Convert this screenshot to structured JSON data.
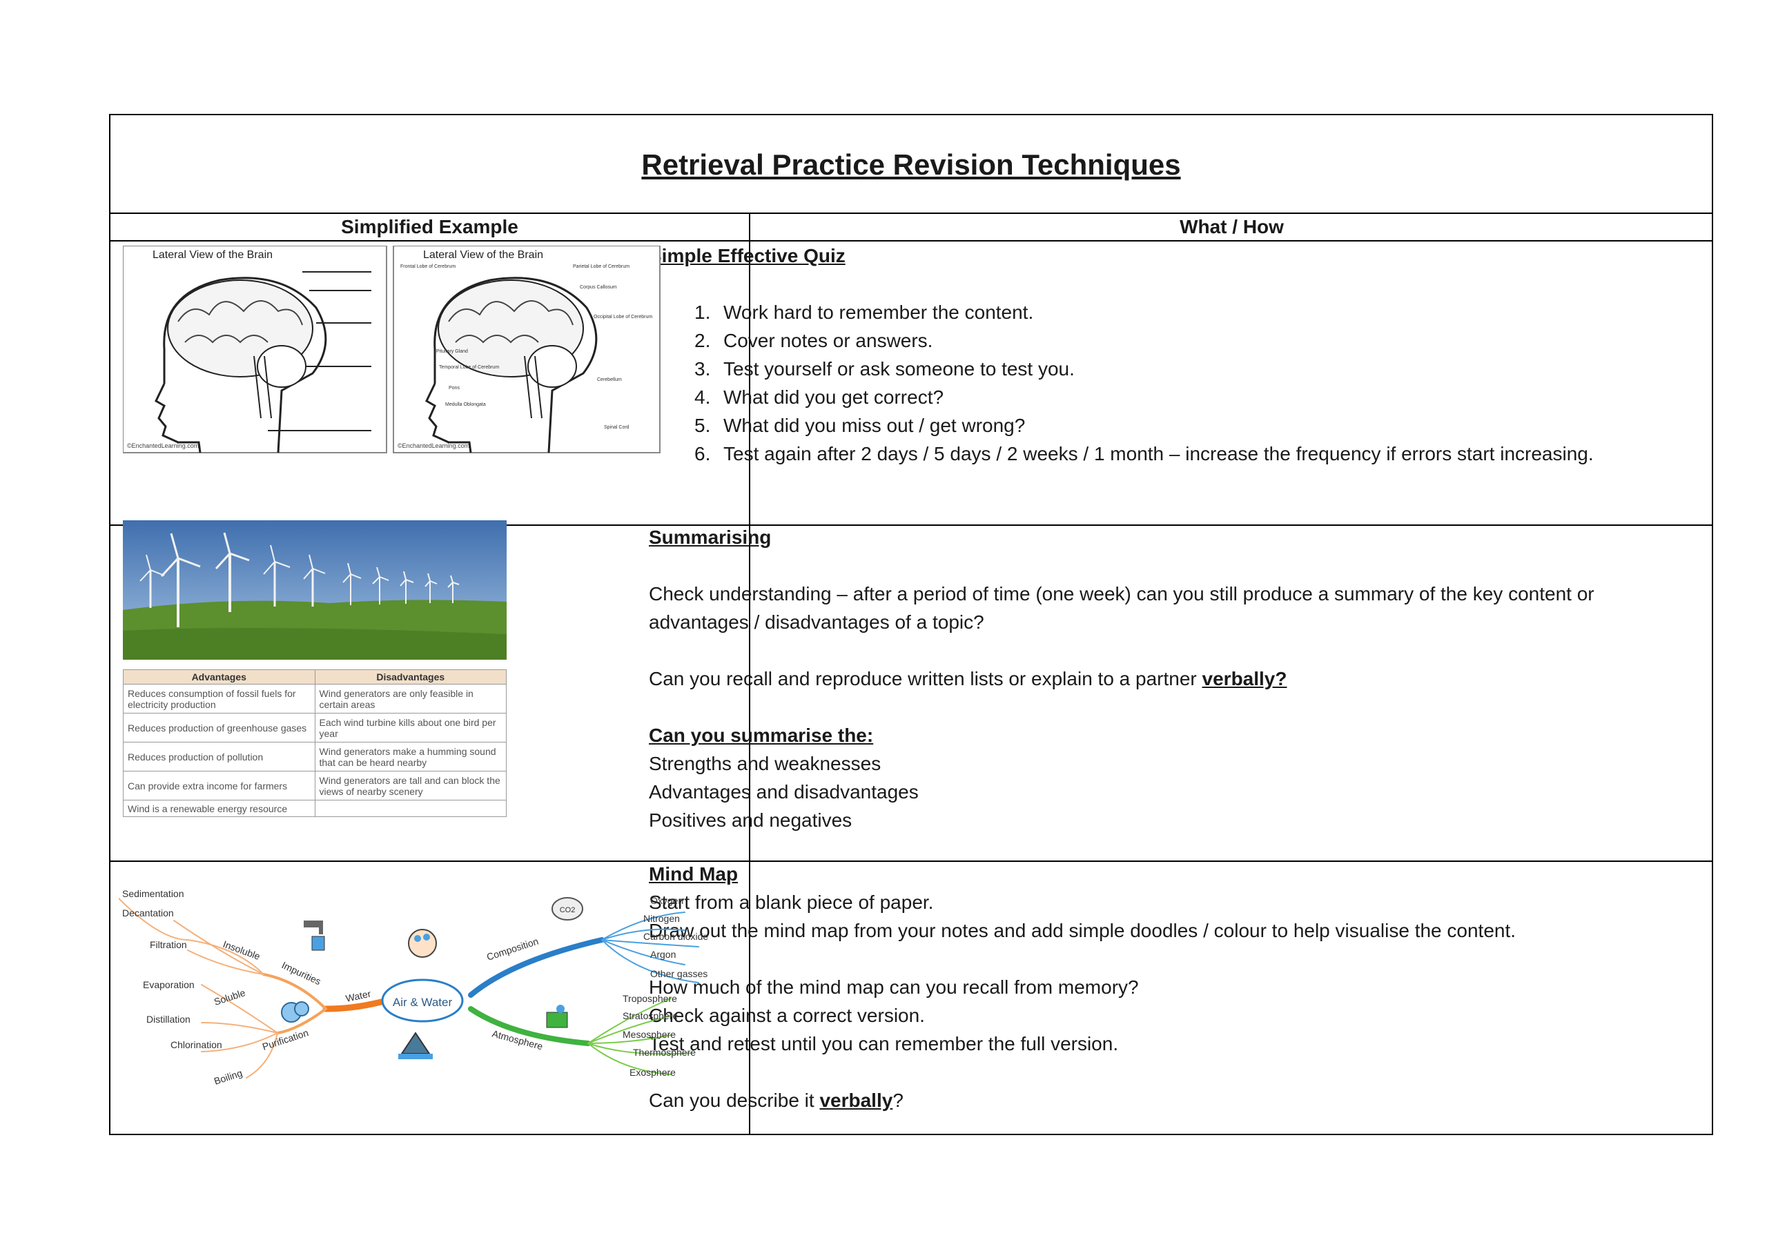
{
  "title": "Retrieval Practice Revision Techniques",
  "headers": {
    "left": "Simplified Example",
    "right": "What / How"
  },
  "quiz": {
    "heading": "Simple Effective Quiz",
    "steps": [
      {
        "num": "1.",
        "text": "Work hard to remember the content."
      },
      {
        "num": "2.",
        "text": "Cover notes or answers."
      },
      {
        "num": "3.",
        "text": "Test yourself or ask someone to test you."
      },
      {
        "num": "4.",
        "text": "What did you get correct?"
      },
      {
        "num": "5.",
        "text": "What did you miss out / get wrong?"
      },
      {
        "num": "6.",
        "text": "Test again after 2 days / 5 days / 2 weeks / 1 month – increase the frequency if errors start increasing."
      }
    ]
  },
  "brain": {
    "title_left": "Lateral View of the Brain",
    "title_right": "Lateral View of the Brain",
    "credit": "©EnchantedLearning.com",
    "labels": [
      "Frontal Lobe of Cerebrum",
      "Parietal Lobe of Cerebrum",
      "Corpus Callosum",
      "Occipital Lobe of Cerebrum",
      "Pituitary Gland",
      "Temporal Lobe of Cerebrum",
      "Pons",
      "Cerebellum",
      "Medulla Oblongata",
      "Spinal Cord"
    ]
  },
  "summarising": {
    "heading": "Summarising",
    "para1": "Check understanding – after a period of time (one week) can you still produce a summary of the key content or advantages / disadvantages of a topic?",
    "para2_pre": "Can you recall and reproduce written lists or explain to a partner ",
    "para2_bold": "verbally?",
    "sub_heading": "Can you summarise the:",
    "items": [
      "Strengths and weaknesses",
      "Advantages and disadvantages",
      "Positives and negatives"
    ]
  },
  "wind_table": {
    "headers": [
      "Advantages",
      "Disadvantages"
    ],
    "rows": [
      [
        "Reduces consumption of fossil fuels for electricity production",
        "Wind generators are only feasible in certain areas"
      ],
      [
        "Reduces production of greenhouse gases",
        "Each wind turbine kills about one bird per year"
      ],
      [
        "Reduces production of pollution",
        "Wind generators make a humming sound that can be heard nearby"
      ],
      [
        "Can provide extra income for farmers",
        "Wind generators are tall and can block the views of nearby scenery"
      ],
      [
        "Wind is a renewable energy resource",
        ""
      ]
    ]
  },
  "mindmap_section": {
    "heading": "Mind Map",
    "line1": "Start from a blank piece of paper.",
    "line2": "Draw out the mind map from your notes and add simple doodles / colour to help visualise the content.",
    "line3": "How much of the mind map can you recall from memory?",
    "line4": "Check against a correct version.",
    "line5": "Test and retest until you can remember the full version.",
    "line6_pre": "Can you describe it ",
    "line6_bold": "verbally",
    "line6_post": "?"
  },
  "mindmap": {
    "center": "Air & Water",
    "left_branch": "Water",
    "left_sub": [
      "Insoluble",
      "Impurities",
      "Soluble",
      "Purification"
    ],
    "left_leaves": [
      "Sedimentation",
      "Decantation",
      "Filtration",
      "Evaporation",
      "Distillation",
      "Chlorination",
      "Boiling"
    ],
    "right_top": "Composition",
    "right_top_leaves": [
      "Oxygen",
      "Nitrogen",
      "Carbon dioxide",
      "Argon",
      "Other gasses"
    ],
    "right_bottom": "Atmosphere",
    "right_bottom_leaves": [
      "Troposphere",
      "Stratosphere",
      "Mesosphere",
      "Thermosphere",
      "Exosphere"
    ],
    "co2_label": "CO2"
  }
}
